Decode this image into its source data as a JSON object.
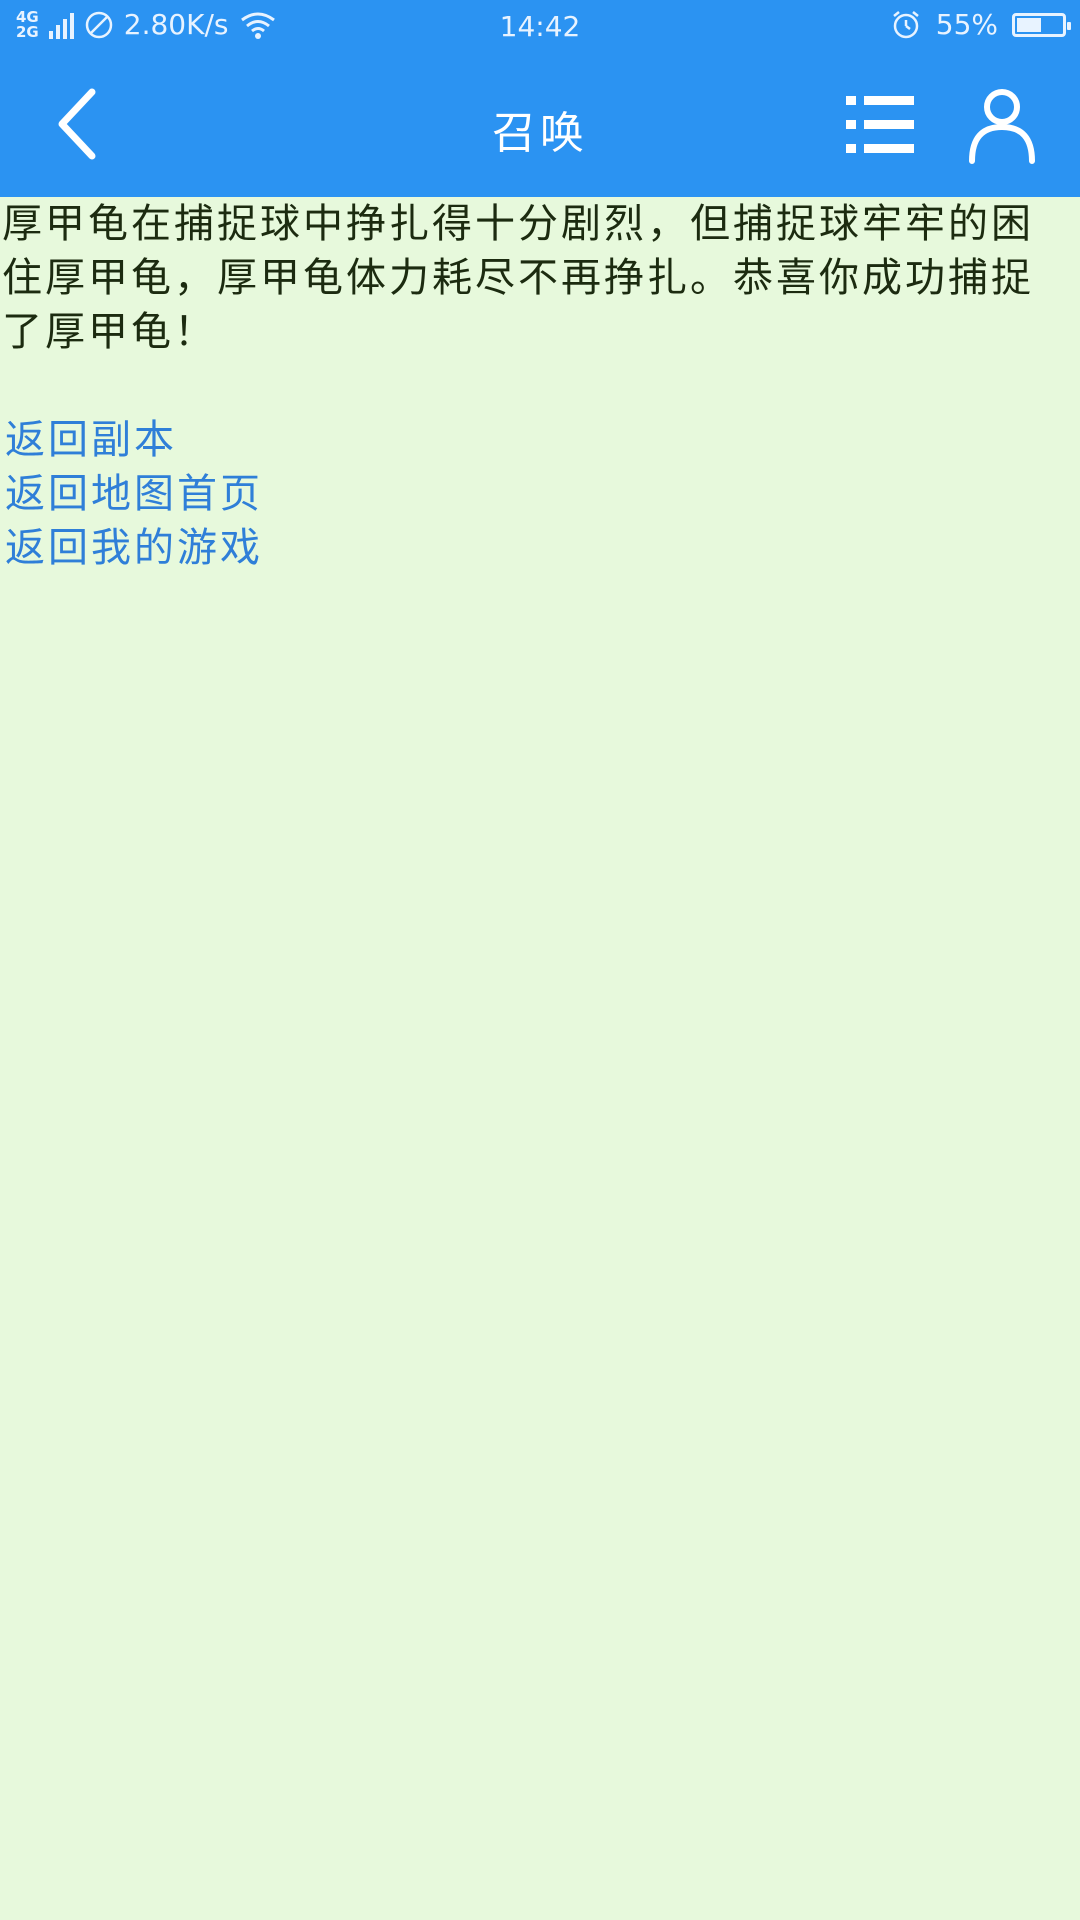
{
  "status_bar": {
    "network_type_top": "4G",
    "network_type_bottom": "2G",
    "speed": "2.80K/s",
    "time": "14:42",
    "battery_percent": "55%",
    "battery_level": 0.55
  },
  "header": {
    "title": "召唤",
    "icons": {
      "back": "chevron-left-icon",
      "menu": "list-icon",
      "user": "user-icon"
    }
  },
  "content": {
    "message": "厚甲龟在捕捉球中挣扎得十分剧烈，但捕捉球牢牢的困住厚甲龟，厚甲龟体力耗尽不再挣扎。恭喜你成功捕捉了厚甲龟！",
    "links": [
      {
        "label": "返回副本"
      },
      {
        "label": "返回地图首页"
      },
      {
        "label": "返回我的游戏"
      }
    ]
  },
  "colors": {
    "header_bg": "#2b93f2",
    "page_bg": "#e7f9dc",
    "text": "#1c2b10",
    "link": "#2f7fd8"
  }
}
